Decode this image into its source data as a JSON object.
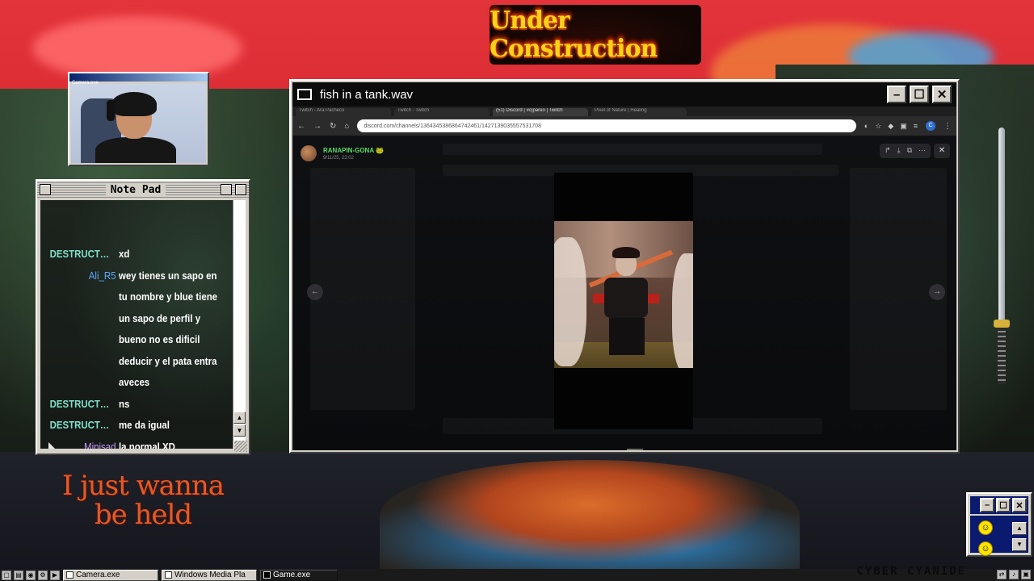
{
  "banner": {
    "text": "Under Construction"
  },
  "camera_window": {
    "title": "Camera.exe"
  },
  "notepad": {
    "title": "Note Pad",
    "messages": [
      {
        "user": "DESTRUCTOR...",
        "text": "xd",
        "color": "#7fe0c9"
      },
      {
        "user": "Ali_R5",
        "text": "wey tienes un sapo en tu nombre y blue tiene un sapo de perfil y bueno no es dificil deducir y el pata entra aveces",
        "color": "#5aa8ff"
      },
      {
        "user": "DESTRUCTOR...",
        "text": "ns",
        "color": "#7fe0c9"
      },
      {
        "user": "DESTRUCTOR...",
        "text": "me da igual",
        "color": "#7fe0c9"
      },
      {
        "user": "Minisad",
        "text": "la normal XD",
        "color": "#c89bff"
      }
    ]
  },
  "media_window": {
    "title": "fish in a tank.wav",
    "browser": {
      "tabs": [
        "Twitch - Ara Pacheco",
        "Twitch - Twitch",
        "(51) Discord | #c|pareo | Twitch",
        "Pixel of Nature | Healing"
      ],
      "url": "discord.com/channels/1364345386864742461/1427139035557531708"
    },
    "viewer": {
      "poster_name": "RANAPIN-GONA 🐸",
      "poster_date": "9/11/25, 23:02"
    }
  },
  "caption": {
    "line1": "I just wanna",
    "line2": "be held"
  },
  "brand": "CYBER CYANIDE",
  "taskbar": {
    "items": [
      "Camera.exe",
      "Windows Media Pla",
      "Game.exe"
    ]
  },
  "colors": {
    "sky": "#e3333b",
    "banner_text": "#ffd21a",
    "caption": "#e25a2a",
    "discord_green": "#5ddc65"
  }
}
